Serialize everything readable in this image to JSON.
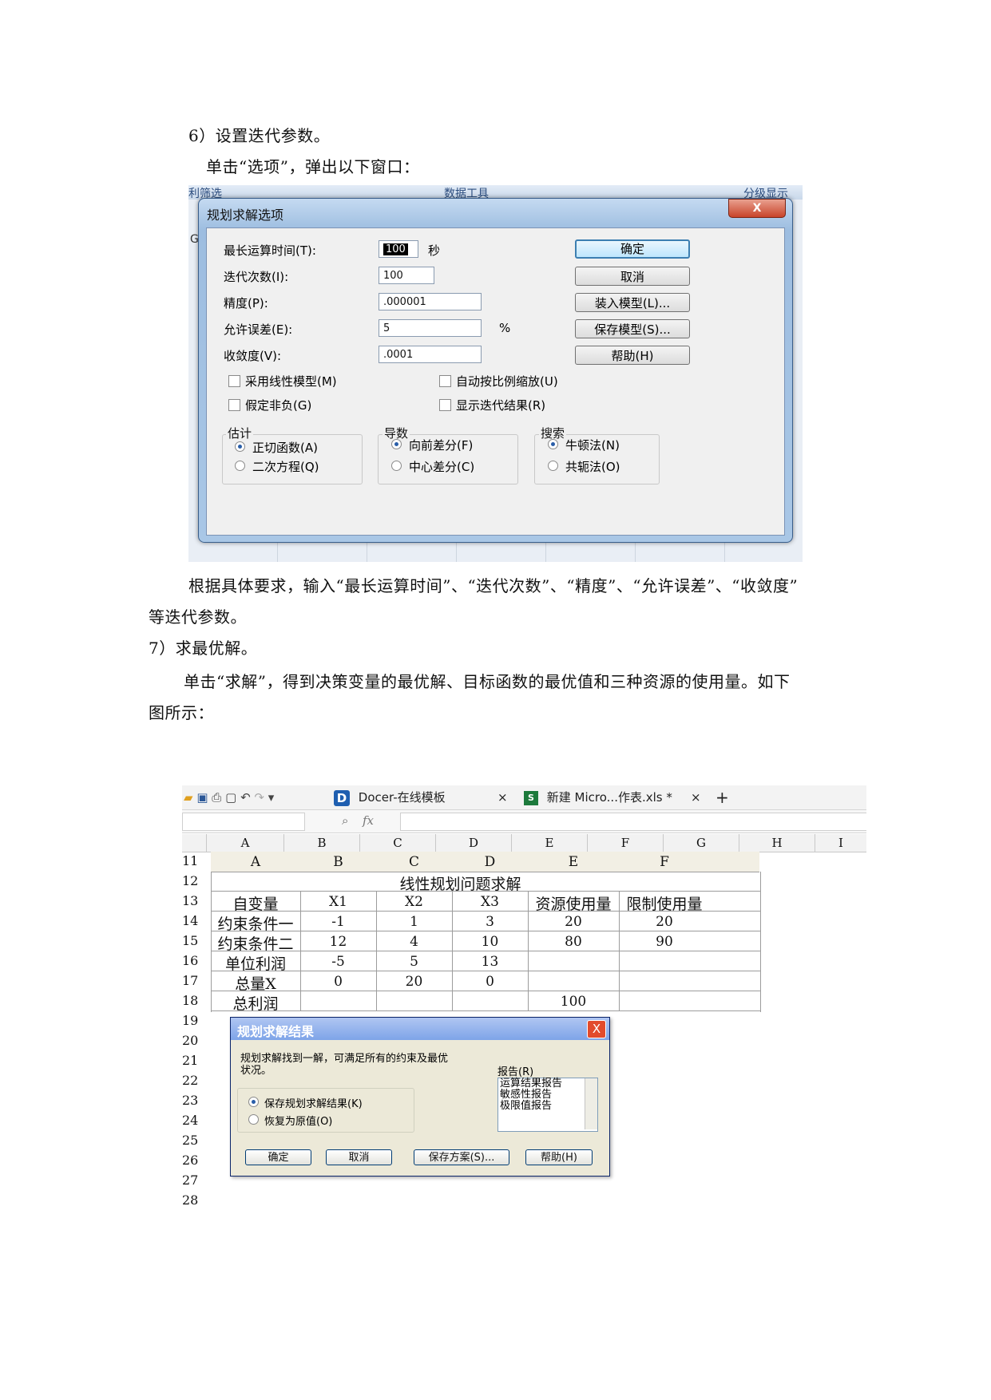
{
  "paragraphs": {
    "step6_title": "6）设置迭代参数。",
    "step6_desc": "单击“选项”，弹出以下窗口：",
    "after_shot1_line1": "根据具体要求，输入“最长运算时间”、“迭代次数”、“精度”、“允许误差”、“收敛度”",
    "after_shot1_line2": "等迭代参数。",
    "step7_title": "7）求最优解。",
    "step7_desc_line1": "单击“求解”，得到决策变量的最优解、目标函数的最优值和三种资源的使用量。如下",
    "step7_desc_line2": "图所示："
  },
  "options_dialog": {
    "background_strip": {
      "left": "利筛选",
      "mid": "数据工具",
      "right": "分级显示",
      "col": "G"
    },
    "title": "规划求解选项",
    "close": "X",
    "fields": [
      {
        "label": "最长运算时间(T):",
        "value": "100",
        "suffix": "秒"
      },
      {
        "label": "迭代次数(I):",
        "value": "100",
        "suffix": ""
      },
      {
        "label": "精度(P):",
        "value": ".000001",
        "suffix": ""
      },
      {
        "label": "允许误差(E):",
        "value": "5",
        "suffix": "%"
      },
      {
        "label": "收敛度(V):",
        "value": ".0001",
        "suffix": ""
      }
    ],
    "buttons": [
      "确定",
      "取消",
      "装入模型(L)...",
      "保存模型(S)...",
      "帮助(H)"
    ],
    "checkboxes": [
      {
        "label": "采用线性模型(M)",
        "checked": false
      },
      {
        "label": "自动按比例缩放(U)",
        "checked": false
      },
      {
        "label": "假定非负(G)",
        "checked": false
      },
      {
        "label": "显示迭代结果(R)",
        "checked": false
      }
    ],
    "groups": [
      {
        "title": "估计",
        "options": [
          {
            "label": "正切函数(A)",
            "selected": true
          },
          {
            "label": "二次方程(Q)",
            "selected": false
          }
        ]
      },
      {
        "title": "导数",
        "options": [
          {
            "label": "向前差分(F)",
            "selected": true
          },
          {
            "label": "中心差分(C)",
            "selected": false
          }
        ]
      },
      {
        "title": "搜索",
        "options": [
          {
            "label": "牛顿法(N)",
            "selected": true
          },
          {
            "label": "共轭法(O)",
            "selected": false
          }
        ]
      }
    ]
  },
  "spreadsheet": {
    "tabs": [
      "Docer-在线模板",
      "新建 Micro...作表.xls *"
    ],
    "tab_close": "×",
    "tab_add": "+",
    "fx": "fx",
    "col_headers": [
      "A",
      "B",
      "C",
      "D",
      "E",
      "F",
      "G",
      "H",
      "I"
    ],
    "row_numbers": [
      "11",
      "12",
      "13",
      "14",
      "15",
      "16",
      "17",
      "18",
      "19",
      "20",
      "21",
      "22",
      "23",
      "24",
      "25",
      "26",
      "27",
      "28"
    ],
    "table_header_row": [
      "A",
      "B",
      "C",
      "D",
      "E",
      "F"
    ],
    "table_title": "线性规划问题求解",
    "rows": [
      [
        "自变量",
        "X1",
        "X2",
        "X3",
        "资源使用量",
        "限制使用量"
      ],
      [
        "约束条件一",
        "-1",
        "1",
        "3",
        "20",
        "20"
      ],
      [
        "约束条件二",
        "12",
        "4",
        "10",
        "80",
        "90"
      ],
      [
        "单位利润",
        "-5",
        "5",
        "13",
        "",
        ""
      ],
      [
        "总量X",
        "0",
        "20",
        "0",
        "",
        ""
      ],
      [
        "总利润",
        "",
        "",
        "",
        "100",
        ""
      ]
    ]
  },
  "result_dialog": {
    "title": "规划求解结果",
    "close": "X",
    "message_line1": "规划求解找到一解，可满足所有的约束及最优",
    "message_line2": "状况。",
    "report_label": "报告(R)",
    "reports": [
      "运算结果报告",
      "敏感性报告",
      "极限值报告"
    ],
    "options": [
      {
        "label": "保存规划求解结果(K)",
        "selected": true
      },
      {
        "label": "恢复为原值(O)",
        "selected": false
      }
    ],
    "buttons": [
      "确定",
      "取消",
      "保存方案(S)...",
      "帮助(H)"
    ]
  }
}
